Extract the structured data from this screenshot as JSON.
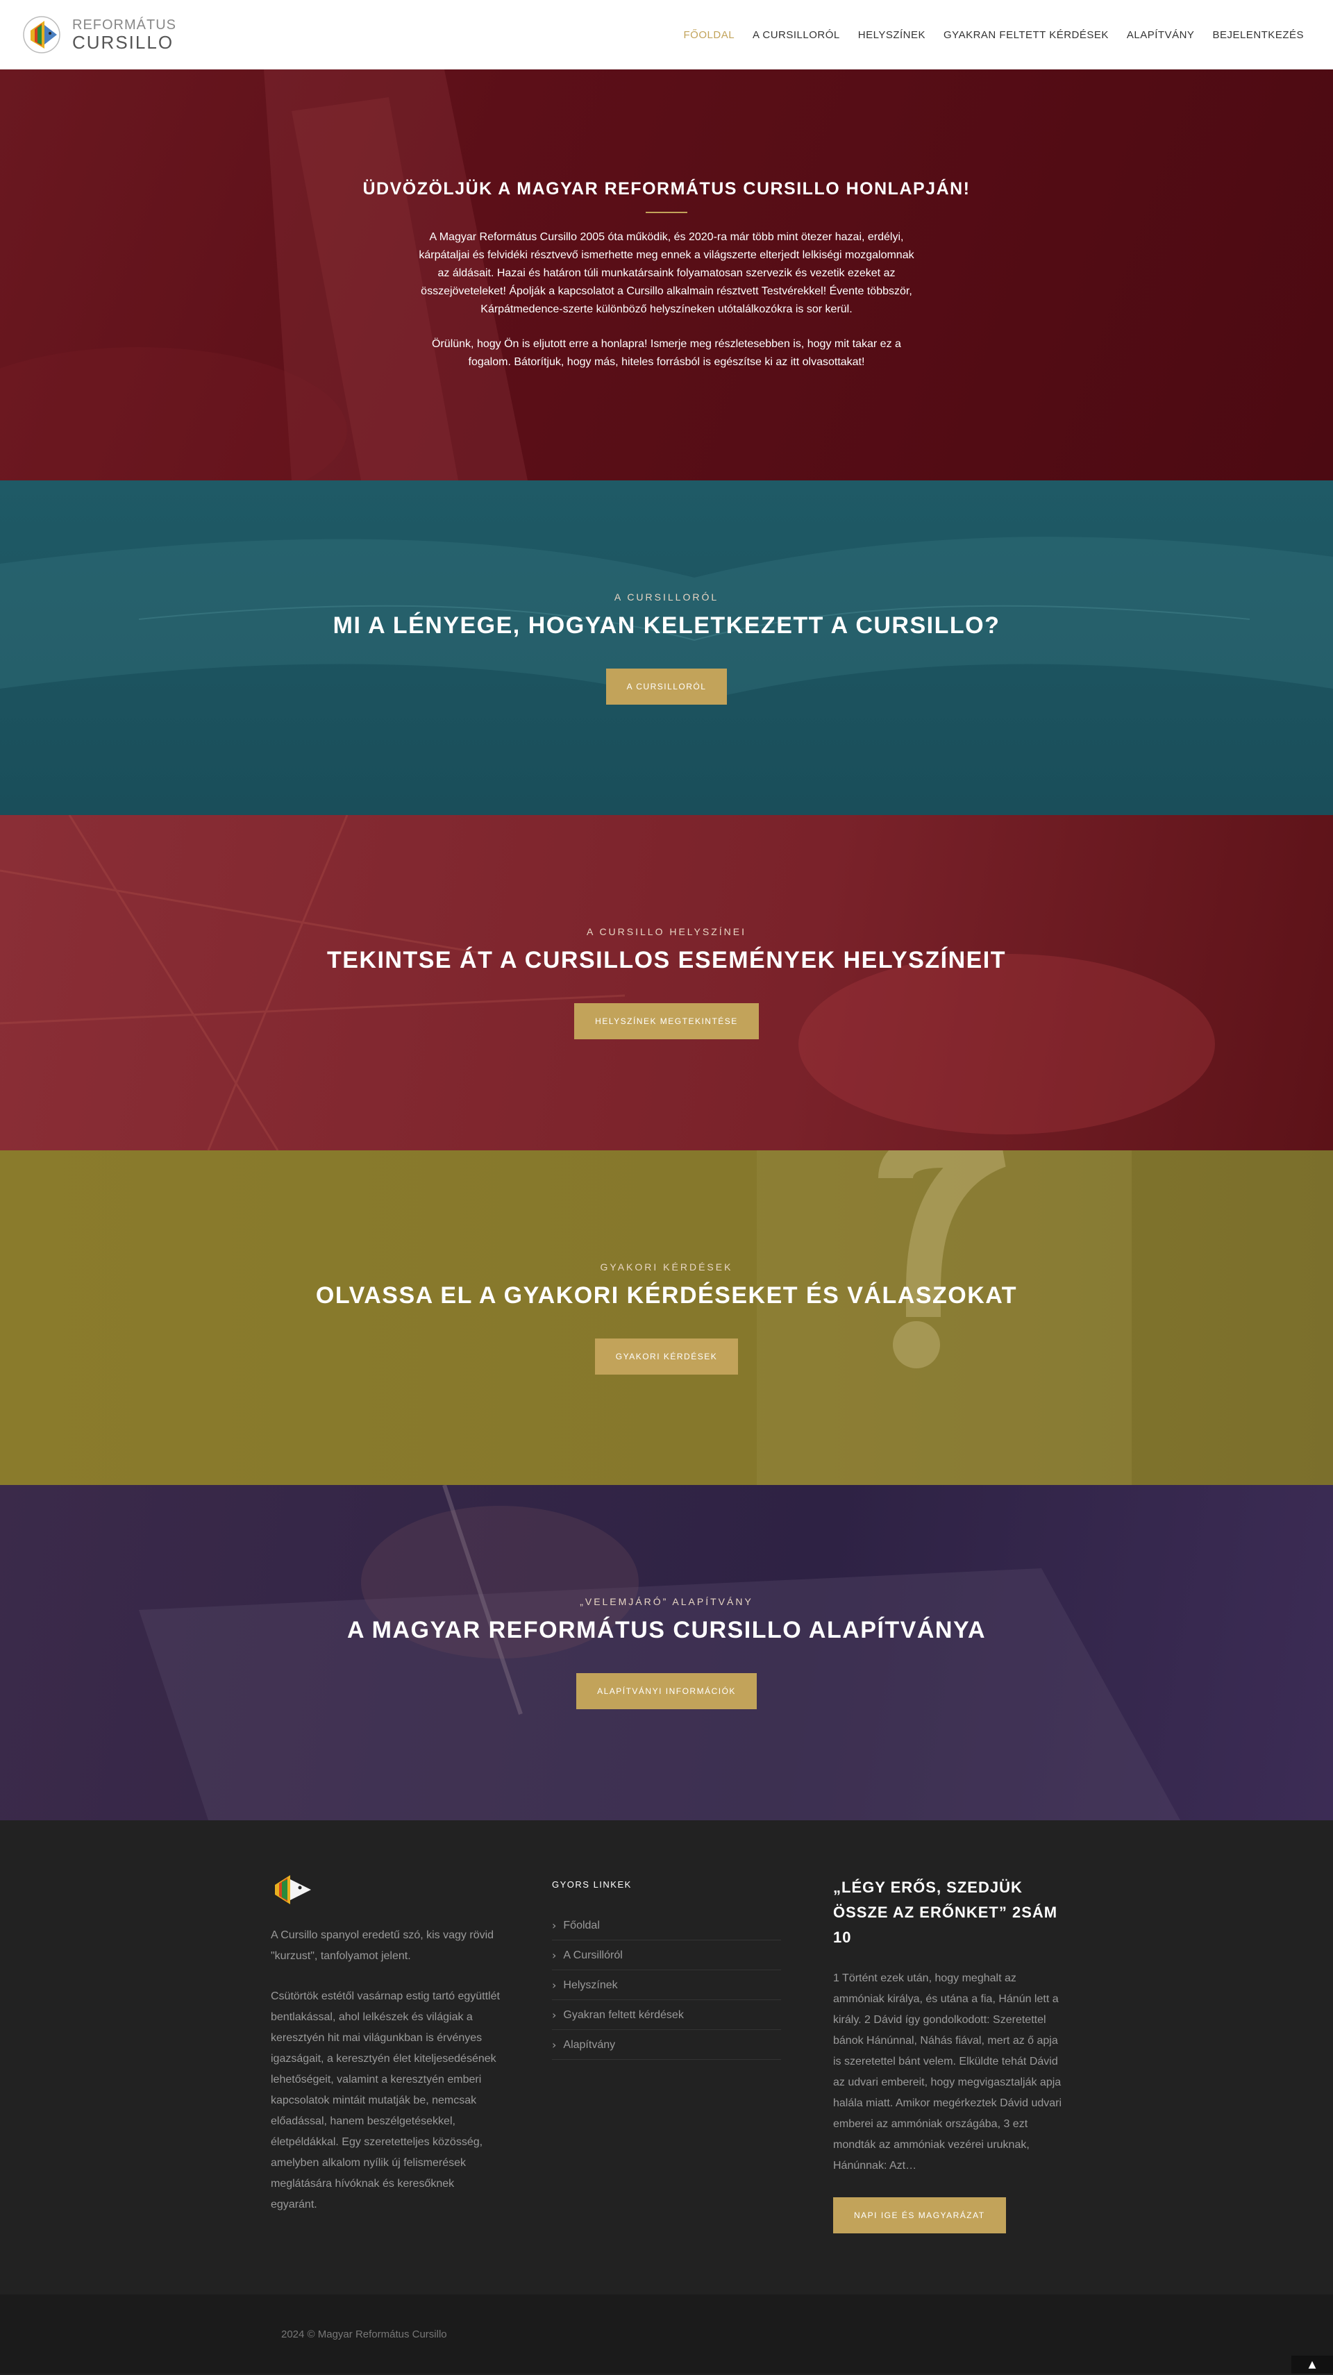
{
  "header": {
    "logo_top": "REFORMÁTUS",
    "logo_bottom": "CURSILLO",
    "nav": [
      {
        "label": "FŐOLDAL"
      },
      {
        "label": "A CURSILLORÓL"
      },
      {
        "label": "HELYSZÍNEK"
      },
      {
        "label": "GYAKRAN FELTETT KÉRDÉSEK"
      },
      {
        "label": "ALAPÍTVÁNY"
      },
      {
        "label": "BEJELENTKEZÉS"
      }
    ],
    "accent_color": "#c2a35a"
  },
  "hero": {
    "title": "ÜDVÖZÖLJÜK A MAGYAR REFORMÁTUS CURSILLO HONLAPJÁN!",
    "paragraph1": "A Magyar Református Cursillo 2005 óta működik, és 2020-ra már több mint ötezer hazai, erdélyi, kárpátaljai és felvidéki résztvevő ismerhette meg ennek a világszerte elterjedt lelkiségi mozgalomnak az áldásait. Hazai és határon túli munkatársaink folyamatosan szervezik és vezetik ezeket az összejöveteleket! Ápolják a kapcsolatot a Cursillo alkalmain résztvett Testvérekkel! Évente többször, Kárpátmedence-szerte különböző helyszíneken utótalálkozókra is sor kerül.",
    "paragraph2": "Örülünk, hogy Ön is eljutott erre a honlapra! Ismerje meg részletesebben is, hogy mit takar ez a fogalom. Bátorítjuk, hogy más, hiteles forrásból is egészítse ki az itt olvasottakat!"
  },
  "sections": [
    {
      "kicker": "A CURSILLORÓL",
      "headline": "MI A LÉNYEGE, HOGYAN KELETKEZETT A CURSILLO?",
      "button": "A CURSILLORÓL"
    },
    {
      "kicker": "A CURSILLO HELYSZÍNEI",
      "headline": "TEKINTSE ÁT A CURSILLOS ESEMÉNYEK HELYSZÍNEIT",
      "button": "HELYSZÍNEK MEGTEKINTÉSE"
    },
    {
      "kicker": "GYAKORI KÉRDÉSEK",
      "headline": "OLVASSA EL A GYAKORI KÉRDÉSEKET ÉS VÁLASZOKAT",
      "button": "GYAKORI KÉRDÉSEK"
    },
    {
      "kicker": "„VELEMJÁRÓ” ALAPÍTVÁNY",
      "headline": "A MAGYAR REFORMÁTUS CURSILLO ALAPÍTVÁNYA",
      "button": "ALAPÍTVÁNYI INFORMÁCIÓK"
    }
  ],
  "footer": {
    "about1": "A Cursillo spanyol eredetű szó, kis vagy rövid \"kurzust\", tanfolyamot jelent.",
    "about2": "Csütörtök estétől vasárnap estig tartó együttlét bentlakással, ahol lelkészek és világiak a keresztyén hit mai világunkban is érvényes igazságait, a keresztyén élet kiteljesedésének lehetőségeit, valamint a keresztyén emberi kapcsolatok mintáit mutatják be, nemcsak előadással, hanem beszélgetésekkel, életpéldákkal. Egy szeretetteljes közösség, amelyben alkalom nyílik új felismerések meglátására hívóknak és keresőknek egyaránt.",
    "quick_links_title": "GYORS LINKEK",
    "quick_links": [
      {
        "label": "Főoldal"
      },
      {
        "label": "A Cursillóról"
      },
      {
        "label": "Helyszínek"
      },
      {
        "label": "Gyakran feltett kérdések"
      },
      {
        "label": "Alapítvány"
      }
    ],
    "verse_title": "„LÉGY ERŐS, SZEDJÜK ÖSSZE AZ ERŐNKET” 2SÁM 10",
    "verse_text": "1 Történt ezek után, hogy meghalt az ammóniak királya, és utána a fia, Hánún lett a király. 2 Dávid így gondolkodott: Szeretettel bánok Hánúnnal, Náhás fiával, mert az ő apja is szeretettel bánt velem. Elküldte tehát Dávid az udvari embereit, hogy megvigasztalják apja halála miatt. Amikor megérkeztek Dávid udvari emberei az ammóniak országába, 3 ezt mondták az ammóniak vezérei uruknak, Hánúnnak: Azt…",
    "verse_button": "NAPI IGE ÉS MAGYARÁZAT"
  },
  "bottom": {
    "copyright": "2024 © Magyar Református Cursillo",
    "to_top_icon": "chevron-up-icon"
  }
}
